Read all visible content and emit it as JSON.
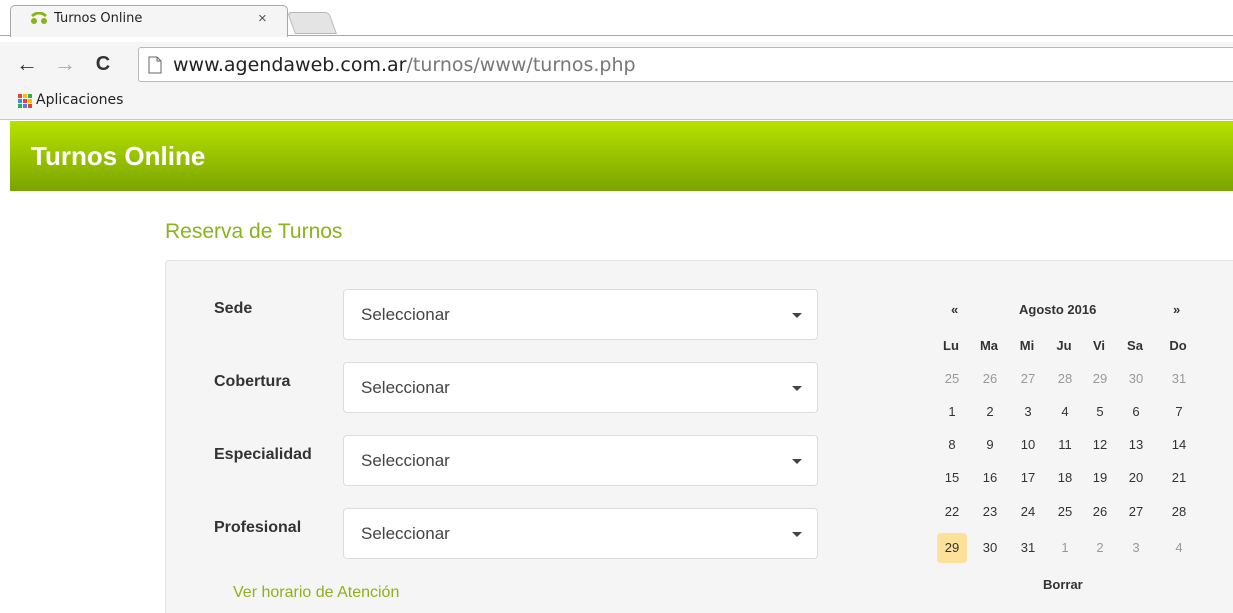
{
  "browser": {
    "tab_title": "Turnos Online",
    "tab_close": "×",
    "url_host": "www.agendaweb.com.ar",
    "url_path": "/turnos/www/turnos.php",
    "back": "←",
    "forward": "→",
    "reload": "C",
    "bookmarks_apps_label": "Aplicaciones"
  },
  "navbar": {
    "brand": "Turnos Online"
  },
  "page": {
    "heading": "Reserva de Turnos"
  },
  "form": {
    "fields": [
      {
        "label": "Sede",
        "value": "Seleccionar"
      },
      {
        "label": "Cobertura",
        "value": "Seleccionar"
      },
      {
        "label": "Especialidad",
        "value": "Seleccionar"
      },
      {
        "label": "Profesional",
        "value": "Seleccionar"
      }
    ],
    "hours_link": "Ver horario de Atención"
  },
  "calendar": {
    "prev": "«",
    "next": "»",
    "title": "Agosto 2016",
    "weekdays": [
      "Lu",
      "Ma",
      "Mi",
      "Ju",
      "Vi",
      "Sa",
      "Do"
    ],
    "weeks": [
      [
        "25",
        "26",
        "27",
        "28",
        "29",
        "30",
        "31"
      ],
      [
        "1",
        "2",
        "3",
        "4",
        "5",
        "6",
        "7"
      ],
      [
        "8",
        "9",
        "10",
        "11",
        "12",
        "13",
        "14"
      ],
      [
        "15",
        "16",
        "17",
        "18",
        "19",
        "20",
        "21"
      ],
      [
        "22",
        "23",
        "24",
        "25",
        "26",
        "27",
        "28"
      ],
      [
        "29",
        "30",
        "31",
        "1",
        "2",
        "3",
        "4"
      ]
    ],
    "today": "29",
    "clear_label": "Borrar"
  },
  "colors": {
    "brand_green": "#8ab31c",
    "navbar_top": "#b7e200",
    "navbar_bottom": "#7aa400",
    "today_highlight": "#fde19a"
  }
}
